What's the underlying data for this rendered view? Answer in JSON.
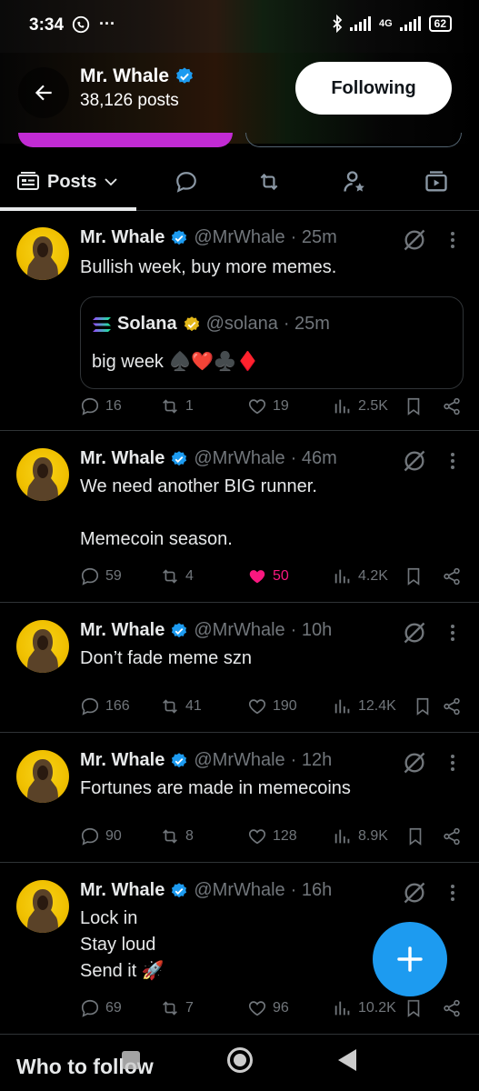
{
  "status": {
    "time": "3:34",
    "left_icons": "···",
    "network": "4G",
    "battery": "62"
  },
  "header": {
    "name": "Mr. Whale",
    "post_count": "38,126 posts",
    "following_label": "Following"
  },
  "tabs": {
    "posts_label": "Posts"
  },
  "posts": [
    {
      "name": "Mr. Whale",
      "handle": "@MrWhale",
      "time": "· 25m",
      "text": "Bullish week, buy more memes.",
      "quote": {
        "name": "Solana",
        "handle": "@solana",
        "time": "· 25m",
        "text": "big week ♠️❤️♣️♦️"
      },
      "replies": "16",
      "reposts": "1",
      "likes": "19",
      "views": "2.5K",
      "liked": false
    },
    {
      "name": "Mr. Whale",
      "handle": "@MrWhale",
      "time": "· 46m",
      "text_lines": [
        "We need another BIG runner.",
        "",
        "Memecoin season."
      ],
      "replies": "59",
      "reposts": "4",
      "likes": "50",
      "views": "4.2K",
      "liked": true
    },
    {
      "name": "Mr. Whale",
      "handle": "@MrWhale",
      "time": "· 10h",
      "text": "Don’t fade meme szn",
      "replies": "166",
      "reposts": "41",
      "likes": "190",
      "views": "12.4K",
      "liked": false
    },
    {
      "name": "Mr. Whale",
      "handle": "@MrWhale",
      "time": "· 12h",
      "text": "Fortunes are made in memecoins",
      "replies": "90",
      "reposts": "8",
      "likes": "128",
      "views": "8.9K",
      "liked": false
    },
    {
      "name": "Mr. Whale",
      "handle": "@MrWhale",
      "time": "· 16h",
      "text_lines": [
        "Lock in",
        "Stay loud",
        "Send it 🚀"
      ],
      "replies": "69",
      "reposts": "7",
      "likes": "96",
      "views": "10.2K",
      "liked": false
    }
  ],
  "bottom": {
    "who_to_follow": "Who to follow"
  },
  "colors": {
    "accent": "#1d9bf0",
    "like": "#f91880",
    "verified": "#1d9bf0",
    "gold_verified": "#e2b719",
    "pink_button": "#c22bd4"
  },
  "icons": [
    "back-arrow-icon",
    "verified-icon",
    "reply-icon",
    "repost-icon",
    "like-icon",
    "views-icon",
    "bookmark-icon",
    "share-icon",
    "grok-icon",
    "more-icon",
    "compose-icon"
  ]
}
